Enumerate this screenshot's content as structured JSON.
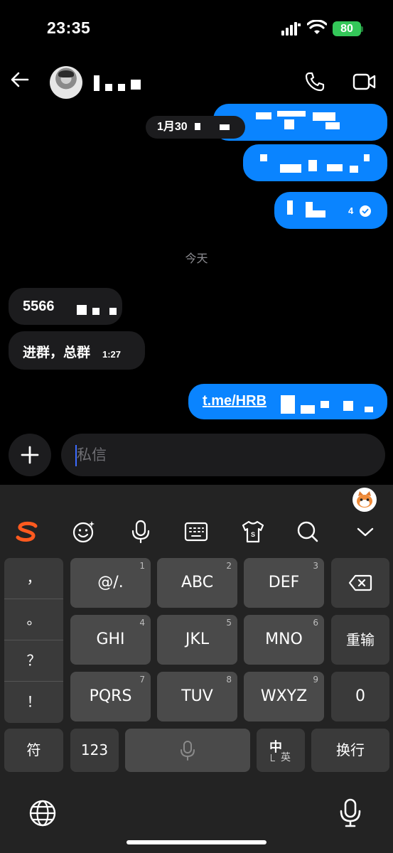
{
  "status_bar": {
    "time": "23:35",
    "battery_percent": "80",
    "icons": [
      "signal-icon",
      "wifi-icon",
      "battery-icon"
    ]
  },
  "header": {
    "contact_name": "",
    "icons": [
      "back-arrow-icon",
      "phone-icon",
      "video-camera-icon"
    ]
  },
  "messages": [
    {
      "direction": "outgoing",
      "date_prefix": "1月30"
    },
    {
      "direction": "outgoing"
    },
    {
      "direction": "outgoing",
      "time_suffix": "4",
      "status": "read"
    },
    {
      "direction": "separator",
      "text": "今天"
    },
    {
      "direction": "incoming",
      "text_prefix": "5566"
    },
    {
      "direction": "incoming",
      "text": "进群，总群",
      "time": "1:27"
    },
    {
      "direction": "outgoing",
      "link_prefix": "t.me/HRB"
    }
  ],
  "composer": {
    "placeholder": "私信",
    "icons": [
      "plus-icon"
    ]
  },
  "keyboard": {
    "toolbar_icons": [
      "sogou-logo-icon",
      "emoji-icon",
      "microphone-icon",
      "keyboard-icon",
      "skin-shirt-icon",
      "search-icon",
      "chevron-down-icon"
    ],
    "punctuation": [
      "，",
      "。",
      "？",
      "！"
    ],
    "rows": [
      [
        {
          "label": "@/.",
          "num": "1"
        },
        {
          "label": "ABC",
          "num": "2"
        },
        {
          "label": "DEF",
          "num": "3"
        },
        {
          "label": "backspace-icon"
        }
      ],
      [
        {
          "label": "GHI",
          "num": "4"
        },
        {
          "label": "JKL",
          "num": "5"
        },
        {
          "label": "MNO",
          "num": "6"
        },
        {
          "label": "重输"
        }
      ],
      [
        {
          "label": "PQRS",
          "num": "7"
        },
        {
          "label": "TUV",
          "num": "8"
        },
        {
          "label": "WXYZ",
          "num": "9"
        },
        {
          "label": "0"
        }
      ]
    ],
    "bottom_row": {
      "symbols": "符",
      "numbers": "123",
      "space_icon": "microphone-icon",
      "lang_main": "中",
      "lang_sub": "英",
      "enter": "换行"
    },
    "footer_icons": [
      "globe-icon",
      "microphone-icon"
    ]
  }
}
